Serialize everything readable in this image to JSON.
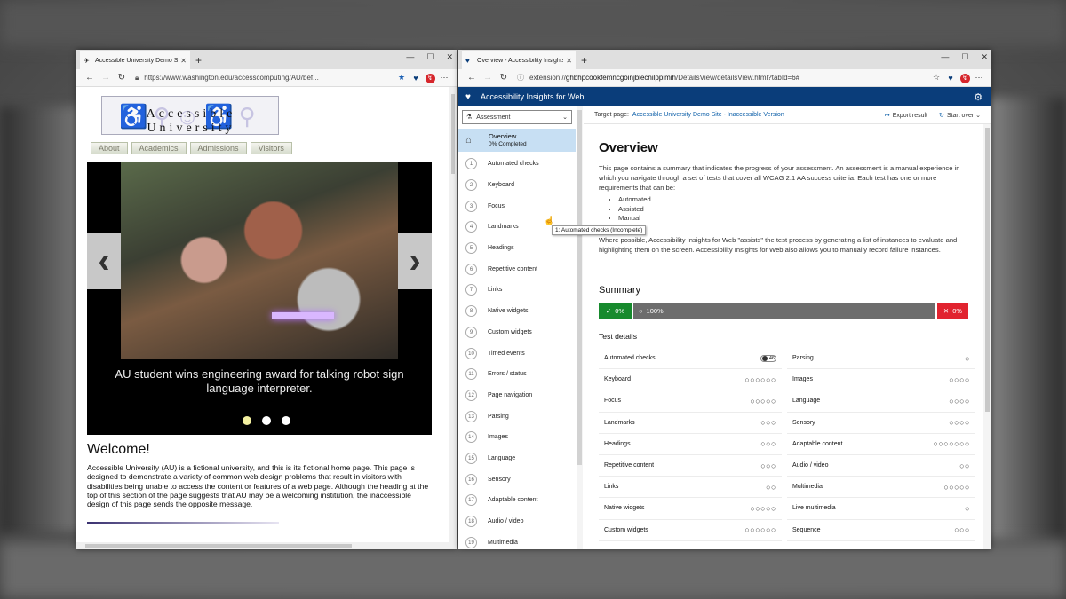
{
  "left_window": {
    "tab_title": "Accessible University Demo Site",
    "url": "https://www.washington.edu/accesscomputing/AU/bef...",
    "page": {
      "logo_text": "Accessible University",
      "menu": [
        "About",
        "Academics",
        "Admissions",
        "Visitors"
      ],
      "slider_caption": "AU student wins engineering award for talking robot sign language interpreter.",
      "slider_dots": 3,
      "slider_active_dot": 1,
      "heading": "Welcome!",
      "paragraph": "Accessible University (AU) is a fictional university, and this is its fictional home page. This page is designed to demonstrate a variety of common web design problems that result in visitors with disabilities being unable to access the content or features of a web page. Although the heading at the top of this section of the page suggests that AU may be a welcoming institution, the inaccessible design of this page sends the opposite message."
    }
  },
  "right_window": {
    "tab_title": "Overview - Accessibility Insights",
    "url_prefix": "extension://",
    "url_host": "ghbhpcookfemncgoinjblecnilppimih",
    "url_path": "/DetailsView/detailsView.html?tabId=6#",
    "app_title": "Accessibility Insights for Web",
    "mode_dropdown": "Assessment",
    "overview_label": "Overview",
    "overview_status": "0% Completed",
    "nav_items": [
      "Automated checks",
      "Keyboard",
      "Focus",
      "Landmarks",
      "Headings",
      "Repetitive content",
      "Links",
      "Native widgets",
      "Custom widgets",
      "Timed events",
      "Errors / status",
      "Page navigation",
      "Parsing",
      "Images",
      "Language",
      "Sensory",
      "Adaptable content",
      "Audio / video",
      "Multimedia"
    ],
    "tooltip": "1: Automated checks (Incomplete)",
    "target_label": "Target page:",
    "target_link": "Accessible University Demo Site - Inaccessible Version",
    "export_label": "Export result",
    "start_over_label": "Start over",
    "overview_title": "Overview",
    "overview_desc": "This page contains a summary that indicates the progress of your assessment. An assessment is a manual experience in which you navigate through a set of tests that cover all WCAG 2.1 AA success criteria. Each test has one or more requirements that can be:",
    "requirement_types": [
      "Automated",
      "Assisted",
      "Manual"
    ],
    "overview_desc2": "Where possible, Accessibility Insights for Web \"assists\" the test process by generating a list of instances to evaluate and highlighting them on the screen. Accessibility Insights for Web also allows you to manually record failure instances.",
    "summary_title": "Summary",
    "summary": {
      "pass": "0%",
      "incomplete": "100%",
      "fail": "0%"
    },
    "test_details_title": "Test details",
    "test_details": [
      {
        "left": {
          "name": "Automated checks",
          "count": "46"
        },
        "right": {
          "name": "Parsing",
          "circles": 1
        }
      },
      {
        "left": {
          "name": "Keyboard",
          "circles": 6
        },
        "right": {
          "name": "Images",
          "circles": 4
        }
      },
      {
        "left": {
          "name": "Focus",
          "circles": 5
        },
        "right": {
          "name": "Language",
          "circles": 4
        }
      },
      {
        "left": {
          "name": "Landmarks",
          "circles": 3
        },
        "right": {
          "name": "Sensory",
          "circles": 4
        }
      },
      {
        "left": {
          "name": "Headings",
          "circles": 3
        },
        "right": {
          "name": "Adaptable content",
          "circles": 7
        }
      },
      {
        "left": {
          "name": "Repetitive content",
          "circles": 3
        },
        "right": {
          "name": "Audio / video",
          "circles": 2
        }
      },
      {
        "left": {
          "name": "Links",
          "circles": 2
        },
        "right": {
          "name": "Multimedia",
          "circles": 5
        }
      },
      {
        "left": {
          "name": "Native widgets",
          "circles": 5
        },
        "right": {
          "name": "Live multimedia",
          "circles": 1
        }
      },
      {
        "left": {
          "name": "Custom widgets",
          "circles": 6
        },
        "right": {
          "name": "Sequence",
          "circles": 3
        }
      }
    ],
    "colors": {
      "header": "#0a3d7a",
      "pass": "#178a2d",
      "fail": "#e1232f",
      "incomplete": "#6d6d6d",
      "link": "#0b5ea8"
    }
  }
}
